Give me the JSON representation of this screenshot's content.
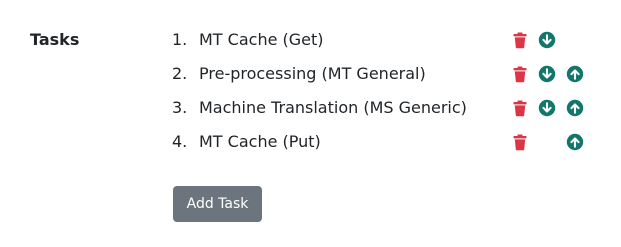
{
  "section": {
    "label": "Tasks"
  },
  "tasks": [
    {
      "number": "1.",
      "name": "MT Cache (Get)",
      "show_delete": true,
      "show_down": true,
      "show_up": false
    },
    {
      "number": "2.",
      "name": "Pre-processing (MT General)",
      "show_delete": true,
      "show_down": true,
      "show_up": true
    },
    {
      "number": "3.",
      "name": "Machine Translation (MS Generic)",
      "show_delete": true,
      "show_down": true,
      "show_up": true
    },
    {
      "number": "4.",
      "name": "MT Cache (Put)",
      "show_delete": true,
      "show_down": false,
      "show_up": true
    }
  ],
  "icons": {
    "delete": "trash-icon",
    "down": "arrow-down-circle-icon",
    "up": "arrow-up-circle-icon"
  },
  "colors": {
    "delete": "#dc3545",
    "move": "#11776b",
    "button_bg": "#6c757d",
    "button_text": "#ffffff",
    "text": "#212529"
  },
  "add_button": {
    "label": "Add Task"
  }
}
